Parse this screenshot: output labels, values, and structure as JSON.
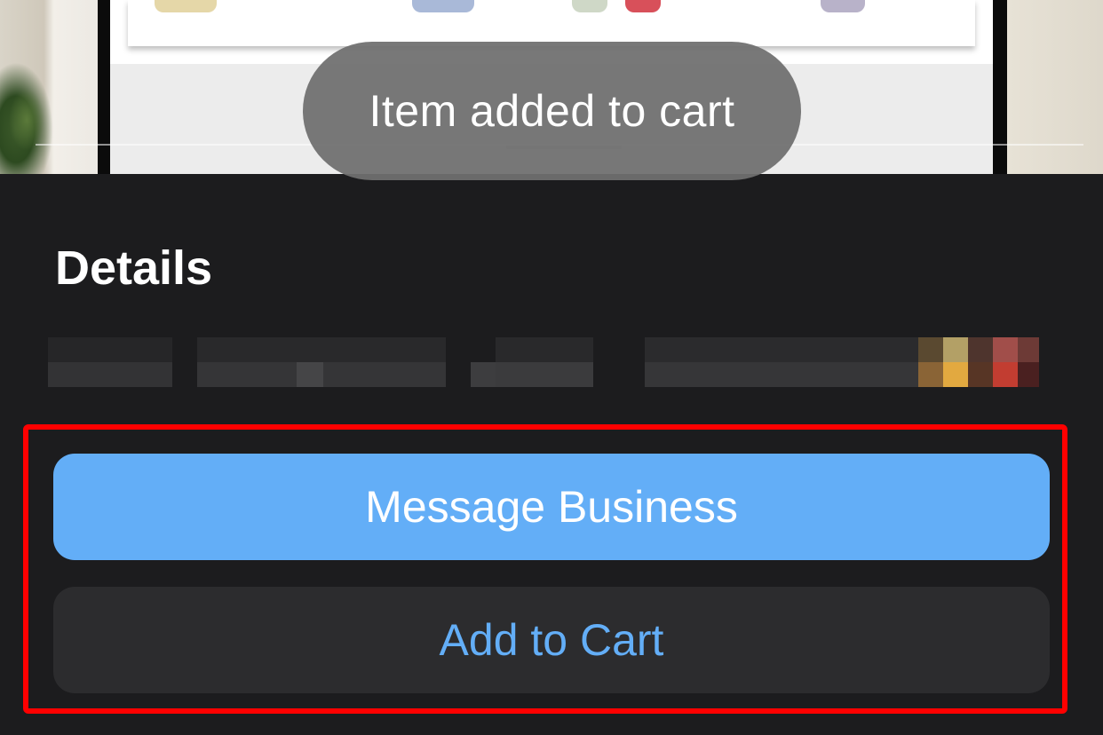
{
  "toast": {
    "message": "Item added to cart"
  },
  "details": {
    "title": "Details"
  },
  "actions": {
    "message_business_label": "Message Business",
    "add_to_cart_label": "Add to Cart"
  },
  "colors": {
    "primary_button": "#63aef7",
    "secondary_button": "#2c2c2e",
    "accent_text": "#63aef7",
    "sheet_background": "#1c1c1e",
    "highlight": "#ff0000"
  }
}
